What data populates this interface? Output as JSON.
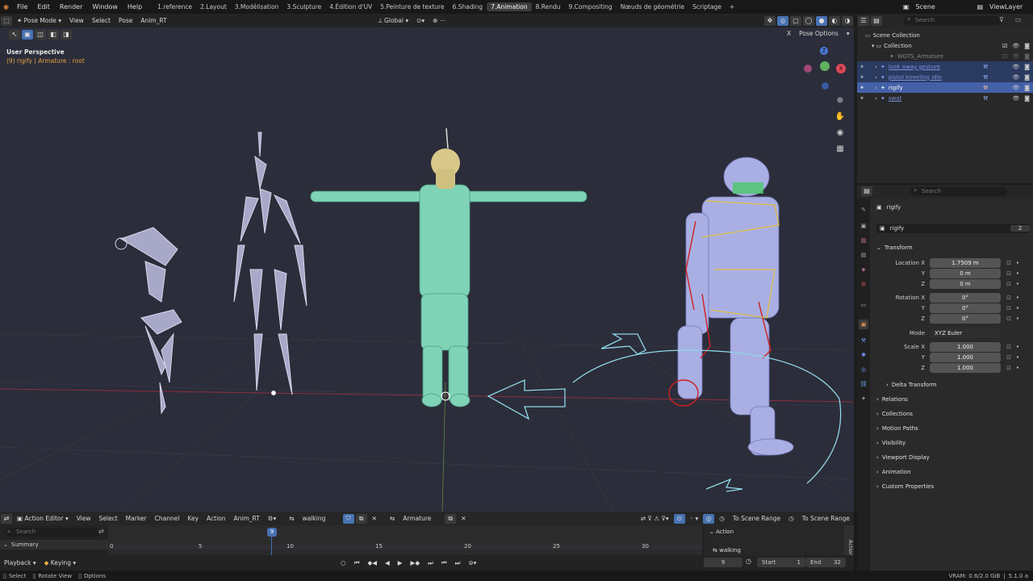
{
  "topbar": {
    "menus": [
      "File",
      "Edit",
      "Render",
      "Window",
      "Help"
    ],
    "workspaces": [
      "1.reference",
      "2.Layout",
      "3.Modélisation",
      "3.Sculpture",
      "4.Édition d'UV",
      "5.Peinture de texture",
      "6.Shading",
      "7.Animation",
      "8.Rendu",
      "9.Compositing",
      "Nœuds de géométrie",
      "Scriptage"
    ],
    "active_workspace": "7.Animation",
    "scene": "Scene",
    "view_layer": "ViewLayer"
  },
  "viewport_header": {
    "mode": "Pose Mode",
    "menus": [
      "View",
      "Select",
      "Pose",
      "Anim_RT"
    ],
    "transform_orientation": "Global",
    "pose_options": "Pose Options",
    "x_label": "X"
  },
  "viewport": {
    "perspective": "User Perspective",
    "object_info": "(9) rigify | Armature : root"
  },
  "outliner": {
    "search_placeholder": "Search",
    "scene_collection": "Scene Collection",
    "collection": "Collection",
    "items": [
      {
        "name": "WGTS_Armature"
      },
      {
        "name": "look away gesture"
      },
      {
        "name": "pistol kneeling idle"
      },
      {
        "name": "rigify"
      },
      {
        "name": "swat"
      }
    ]
  },
  "properties": {
    "search_placeholder": "Search",
    "object_name": "rigify",
    "datablock_name": "rigify",
    "user_count": "2",
    "transform_label": "Transform",
    "location": {
      "label": "Location X",
      "x": "1.7509 m",
      "y": "0 m",
      "z": "0 m"
    },
    "rotation": {
      "label": "Rotation X",
      "x": "0°",
      "y": "0°",
      "z": "0°"
    },
    "mode": {
      "label": "Mode",
      "value": "XYZ Euler"
    },
    "scale": {
      "label": "Scale X",
      "x": "1.000",
      "y": "1.000",
      "z": "1.000"
    },
    "axis_y": "Y",
    "axis_z": "Z",
    "sections": [
      "Delta Transform",
      "Relations",
      "Collections",
      "Motion Paths",
      "Visibility",
      "Viewport Display",
      "Animation",
      "Custom Properties"
    ]
  },
  "action_editor": {
    "editor_type": "Action Editor",
    "menus": [
      "View",
      "Select",
      "Marker",
      "Channel",
      "Key",
      "Action",
      "Anim_RT"
    ],
    "action_name": "walking",
    "armature_name": "Armature",
    "scene_range_1": "To Scene Range",
    "scene_range_2": "To Scene Range",
    "search_placeholder": "Search",
    "summary": "Summary",
    "frame_ticks": [
      "0",
      "5",
      "10",
      "15",
      "20",
      "25",
      "30"
    ],
    "current_frame": "9",
    "side_panel_title": "Action",
    "side_action": "walking",
    "side_tab": "Action"
  },
  "timeline": {
    "playback": "Playback",
    "keying": "Keying",
    "frame": "9",
    "start_label": "Start",
    "start": "1",
    "end_label": "End",
    "end": "32"
  },
  "statusbar": {
    "select": "Select",
    "rotate_view": "Rotate View",
    "options": "Options",
    "vram": "VRAM: 0.6/2.0 GiB",
    "version": "5.1.0 a"
  },
  "colors": {
    "accent": "#4772b3",
    "keyframe": "#f0b040",
    "viewport_bg": "#2c2d3a",
    "soldier_green": "#7fd3b6",
    "soldier_blue": "#a9afe3"
  }
}
